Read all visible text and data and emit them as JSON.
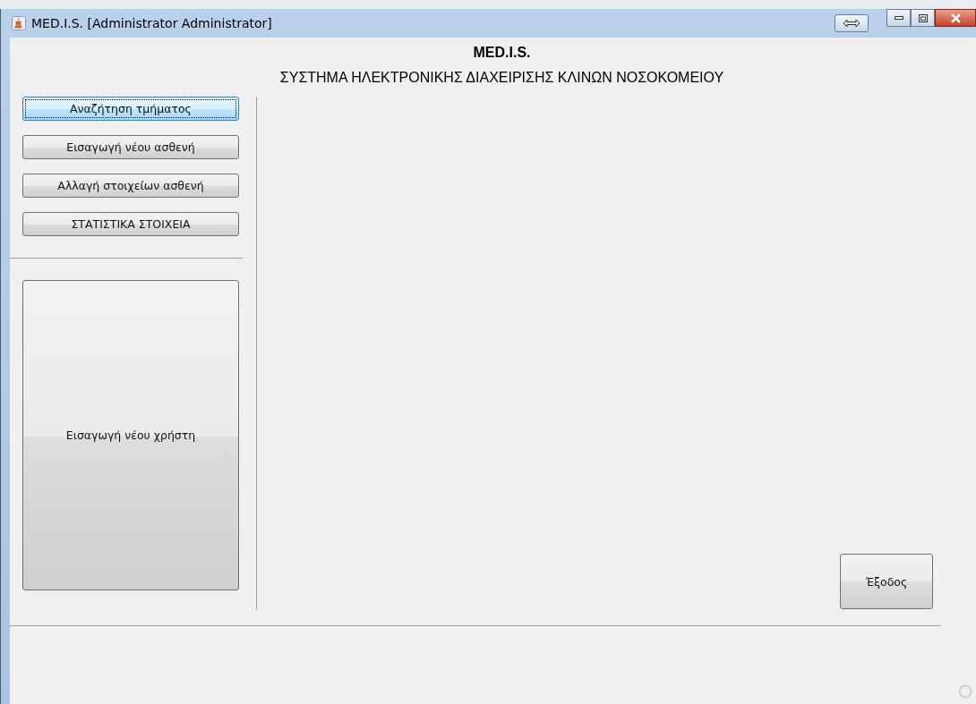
{
  "window": {
    "title": "MED.I.S. [Administrator Administrator]"
  },
  "header": {
    "title": "MED.I.S.",
    "subtitle": "ΣΥΣΤΗΜΑ ΗΛΕΚΤΡΟΝΙΚΗΣ ΔΙΑΧΕΙΡΙΣΗΣ ΚΛΙΝΩΝ ΝΟΣΟΚΟΜΕΙΟΥ"
  },
  "menu_buttons": [
    {
      "label": "Αναζήτηση τμήματος",
      "focused": true
    },
    {
      "label": "Εισαγωγή νέου ασθενή",
      "focused": false
    },
    {
      "label": "Αλλαγή στοιχείων ασθενή",
      "focused": false
    },
    {
      "label": "ΣΤΑΤΙΣΤΙΚΑ ΣΤΟΙΧΕΙΑ",
      "focused": false
    }
  ],
  "user_button": {
    "label": "Εισαγωγή νέου χρήστη"
  },
  "exit_button": {
    "label": "Έξοδος"
  }
}
